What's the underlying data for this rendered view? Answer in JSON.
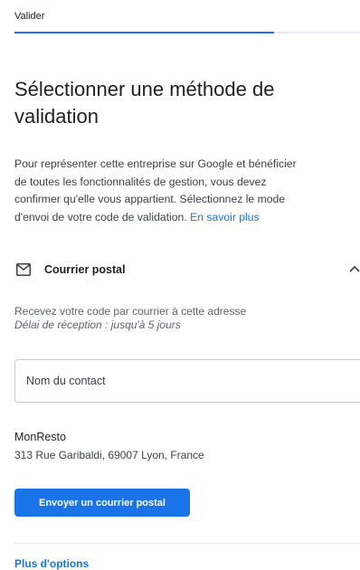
{
  "stepper": {
    "current_step": "Valider",
    "progress_fraction": 0.75
  },
  "page": {
    "title": "Sélectionner une méthode de validation",
    "description_lines": [
      "Pour représenter cette entreprise sur Google et bénéficier",
      "de toutes les fonctionnalités de gestion, vous devez",
      "confirmer qu'elle vous appartient. Sélectionnez le mode",
      "d'envoi de votre code de validation."
    ],
    "learn_more_link": "En savoir plus"
  },
  "method": {
    "icon": "mail-icon",
    "label": "Courrier postal",
    "expand_icon": "chevron-up-icon",
    "expanded": true,
    "receive_text": "Recevez votre code par courrier à cette adresse",
    "delay_text": "Délai de réception : jusqu'à 5 jours",
    "contact_field": {
      "placeholder": "Nom du contact",
      "value": ""
    },
    "business_name": "MonResto",
    "business_address": "313 Rue Garibaldi, 69007 Lyon, France",
    "send_button_label": "Envoyer un courrier postal"
  },
  "footer": {
    "more_options_link": "Plus d'options"
  },
  "colors": {
    "accent": "#1a73e8",
    "text_primary": "#202124",
    "text_secondary": "#5f6368",
    "track": "#e8eaed"
  }
}
